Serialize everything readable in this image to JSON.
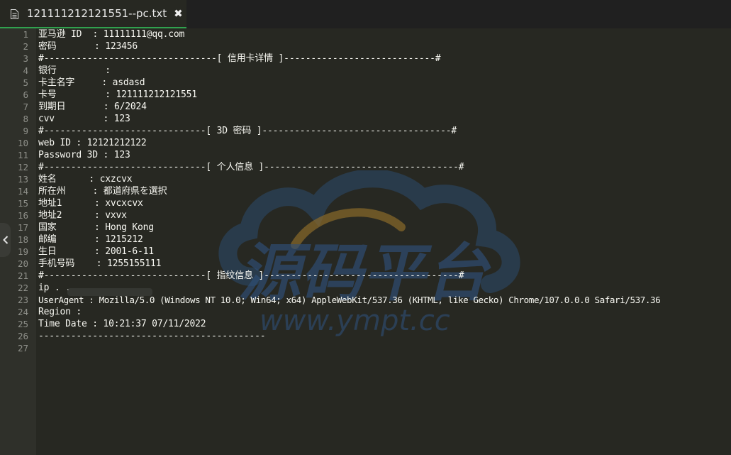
{
  "tab": {
    "title": "121111212121551--pc.txt",
    "close_label": "✖",
    "icon": "document-icon"
  },
  "colors": {
    "background": "#272822",
    "gutter": "#2f302a",
    "text": "#f8f8f2",
    "line_number": "#8f908a",
    "tab_accent": "#30a14e"
  },
  "lines": [
    {
      "n": "1",
      "text": "亚马逊 ID  : 11111111@qq.com"
    },
    {
      "n": "2",
      "text": "密码       : 123456"
    },
    {
      "n": "3",
      "text": "#--------------------------------[ 信用卡详情 ]----------------------------#"
    },
    {
      "n": "4",
      "text": "银行         :"
    },
    {
      "n": "5",
      "text": "卡主名字     : asdasd"
    },
    {
      "n": "6",
      "text": "卡号         : 121111212121551"
    },
    {
      "n": "7",
      "text": "到期日       : 6/2024"
    },
    {
      "n": "8",
      "text": "cvv         : 123"
    },
    {
      "n": "9",
      "text": "#------------------------------[ 3D 密码 ]-----------------------------------#"
    },
    {
      "n": "10",
      "text": "web ID : 12121212122"
    },
    {
      "n": "11",
      "text": "Password 3D : 123"
    },
    {
      "n": "12",
      "text": "#------------------------------[ 个人信息 ]------------------------------------#"
    },
    {
      "n": "13",
      "text": "姓名      : cxzcvx"
    },
    {
      "n": "14",
      "text": "所在州     : 都道府県を選択"
    },
    {
      "n": "15",
      "text": "地址1      : xvcxcvx"
    },
    {
      "n": "16",
      "text": "地址2      : vxvx"
    },
    {
      "n": "17",
      "text": "国家       : Hong Kong"
    },
    {
      "n": "18",
      "text": "邮编       : 1215212"
    },
    {
      "n": "19",
      "text": "生日       : 2001-6-11"
    },
    {
      "n": "20",
      "text": "手机号码    : 1255155111"
    },
    {
      "n": "21",
      "text": "#------------------------------[ 指纹信息 ]------------------------------------#"
    },
    {
      "n": "22",
      "text": "ip . ."
    },
    {
      "n": "23",
      "text": "UserAgent : Mozilla/5.0 (Windows NT 10.0; Win64; x64) AppleWebKit/537.36 (KHTML, like Gecko) Chrome/107.0.0.0 Safari/537.36"
    },
    {
      "n": "24",
      "text": "Region :"
    },
    {
      "n": "25",
      "text": "Time Date : 10:21:37 07/11/2022"
    },
    {
      "n": "26",
      "text": "------------------------------------------"
    },
    {
      "n": "27",
      "text": ""
    }
  ],
  "watermark": {
    "logo_text": "源码平台",
    "url_text": "www.ympt.cc"
  }
}
